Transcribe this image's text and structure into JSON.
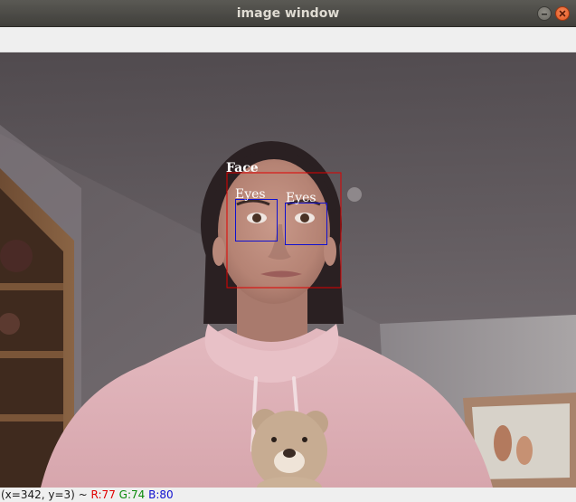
{
  "window": {
    "title": "image window",
    "controls": [
      "minimize-icon",
      "close-icon"
    ]
  },
  "image": {
    "detections": {
      "face": {
        "label": "Face",
        "box_color": "#e00000"
      },
      "eyes": [
        {
          "label": "Eyes",
          "box_color": "#1010d0"
        },
        {
          "label": "Eyes",
          "box_color": "#1010d0"
        }
      ]
    },
    "colors": {
      "face_box": "#e00000",
      "eye_box": "#1010d0",
      "label_text": "#ffffff"
    }
  },
  "status": {
    "coords": "(x=342, y=3) ~",
    "r": "R:77",
    "g": "G:74",
    "b": "B:80",
    "colors": {
      "r": "#e00000",
      "g": "#0a8a0a",
      "b": "#1010d0"
    }
  }
}
